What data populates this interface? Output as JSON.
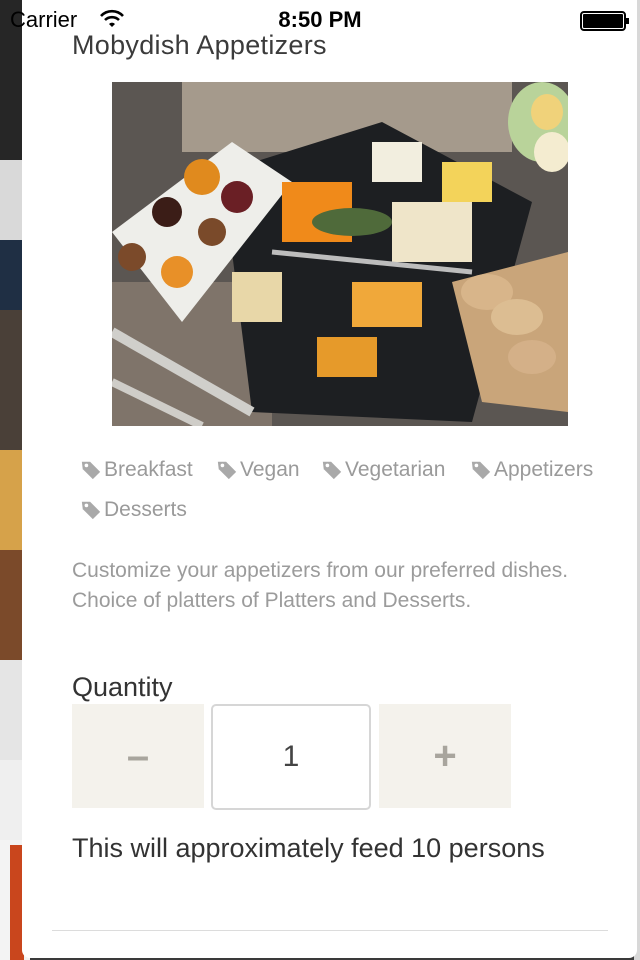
{
  "status_bar": {
    "carrier": "Carrier",
    "time": "8:50 PM"
  },
  "product": {
    "title": "Mobydish Appetizers",
    "image_alt": "Cheese and appetizer platter",
    "tags": [
      "Breakfast",
      "Vegan",
      "Vegetarian",
      "Appetizers",
      "Desserts"
    ],
    "description": "Customize your appetizers from our preferred dishes. Choice of platters of Platters and Desserts.",
    "quantity_label": "Quantity",
    "quantity_value": "1",
    "decrement_label": "–",
    "increment_label": "+",
    "feed_note": "This will approximately feed 10 persons"
  },
  "icons": {
    "tag": "tag-icon",
    "wifi": "wifi-icon",
    "battery": "battery-icon"
  },
  "colors": {
    "tag_text": "#9a9a9a",
    "stepper_bg": "#f4f2ec",
    "stepper_symbol": "#a8a59d"
  }
}
